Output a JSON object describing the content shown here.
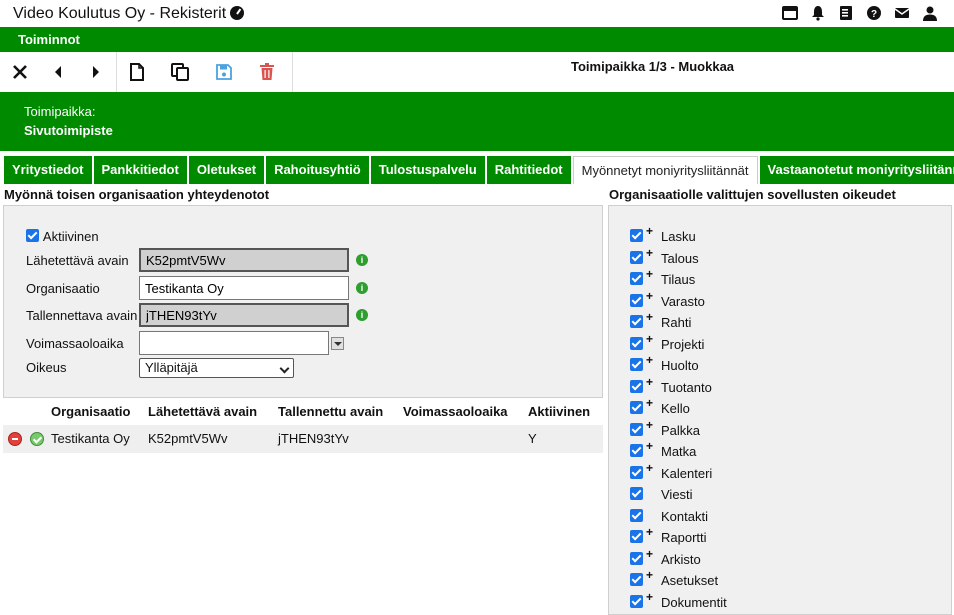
{
  "app": {
    "title": "Video Koulutus Oy - Rekisterit",
    "top_icons": [
      "window-icon",
      "bell-icon",
      "book-icon",
      "help-icon",
      "mail-icon",
      "user-icon"
    ]
  },
  "menubar": {
    "label": "Toiminnot"
  },
  "toolbar": {
    "title": "Toimipaikka 1/3 - Muokkaa",
    "buttons": [
      "close-icon",
      "previous-icon",
      "next-icon",
      "new-document-icon",
      "copy-icon",
      "save-icon",
      "delete-icon"
    ]
  },
  "info": {
    "label": "Toimipaikka:",
    "value": "Sivutoimipiste"
  },
  "tabs": [
    {
      "label": "Yritystiedot"
    },
    {
      "label": "Pankkitiedot"
    },
    {
      "label": "Oletukset"
    },
    {
      "label": "Rahoitusyhtiö"
    },
    {
      "label": "Tulostuspalvelu"
    },
    {
      "label": "Rahtitiedot"
    },
    {
      "label": "Myönnetyt moniyritysliitännät"
    },
    {
      "label": "Vastaanotetut moniyritysliitännät"
    }
  ],
  "active_tab": 6,
  "left": {
    "title": "Myönnä toisen organisaation yhteydenotot",
    "active_label": "Aktiivinen",
    "active_checked": true,
    "fields": {
      "send_key_label": "Lähetettävä avain",
      "send_key_value": "K52pmtV5Wv",
      "org_label": "Organisaatio",
      "org_value": "Testikanta Oy",
      "store_key_label": "Tallennettava avain",
      "store_key_value": "jTHEN93tYv",
      "validity_label": "Voimassaoloaika",
      "validity_value": "",
      "right_label": "Oikeus",
      "right_value": "Ylläpitäjä"
    },
    "table": {
      "headers": [
        "Organisaatio",
        "Lähetettävä avain",
        "Tallennettu avain",
        "Voimassaoloaika",
        "Aktiivinen"
      ],
      "rows": [
        [
          "Testikanta Oy",
          "K52pmtV5Wv",
          "jTHEN93tYv",
          "",
          "Y"
        ]
      ]
    }
  },
  "right": {
    "title": "Organisaatiolle valittujen sovellusten oikeudet",
    "items": [
      {
        "label": "Lasku",
        "checked": true,
        "plus": "+"
      },
      {
        "label": "Talous",
        "checked": true,
        "plus": "+"
      },
      {
        "label": "Tilaus",
        "checked": true,
        "plus": "+"
      },
      {
        "label": "Varasto",
        "checked": true,
        "plus": "+"
      },
      {
        "label": "Rahti",
        "checked": true,
        "plus": "+"
      },
      {
        "label": "Projekti",
        "checked": true,
        "plus": "+"
      },
      {
        "label": "Huolto",
        "checked": true,
        "plus": "+"
      },
      {
        "label": "Tuotanto",
        "checked": true,
        "plus": "+"
      },
      {
        "label": "Kello",
        "checked": true,
        "plus": "+"
      },
      {
        "label": "Palkka",
        "checked": true,
        "plus": "+"
      },
      {
        "label": "Matka",
        "checked": true,
        "plus": "+"
      },
      {
        "label": "Kalenteri",
        "checked": true,
        "plus": "+"
      },
      {
        "label": "Viesti",
        "checked": true,
        "plus": ""
      },
      {
        "label": "Kontakti",
        "checked": true,
        "plus": ""
      },
      {
        "label": "Raportti",
        "checked": true,
        "plus": "+"
      },
      {
        "label": "Arkisto",
        "checked": true,
        "plus": "+"
      },
      {
        "label": "Asetukset",
        "checked": true,
        "plus": "+"
      },
      {
        "label": "Dokumentit",
        "checked": true,
        "plus": "+"
      }
    ]
  },
  "colors": {
    "brand_green": "#008a00",
    "checkbox_blue": "#1a73e8",
    "delete_red": "#e0413a",
    "save_blue": "#4aa3df"
  }
}
